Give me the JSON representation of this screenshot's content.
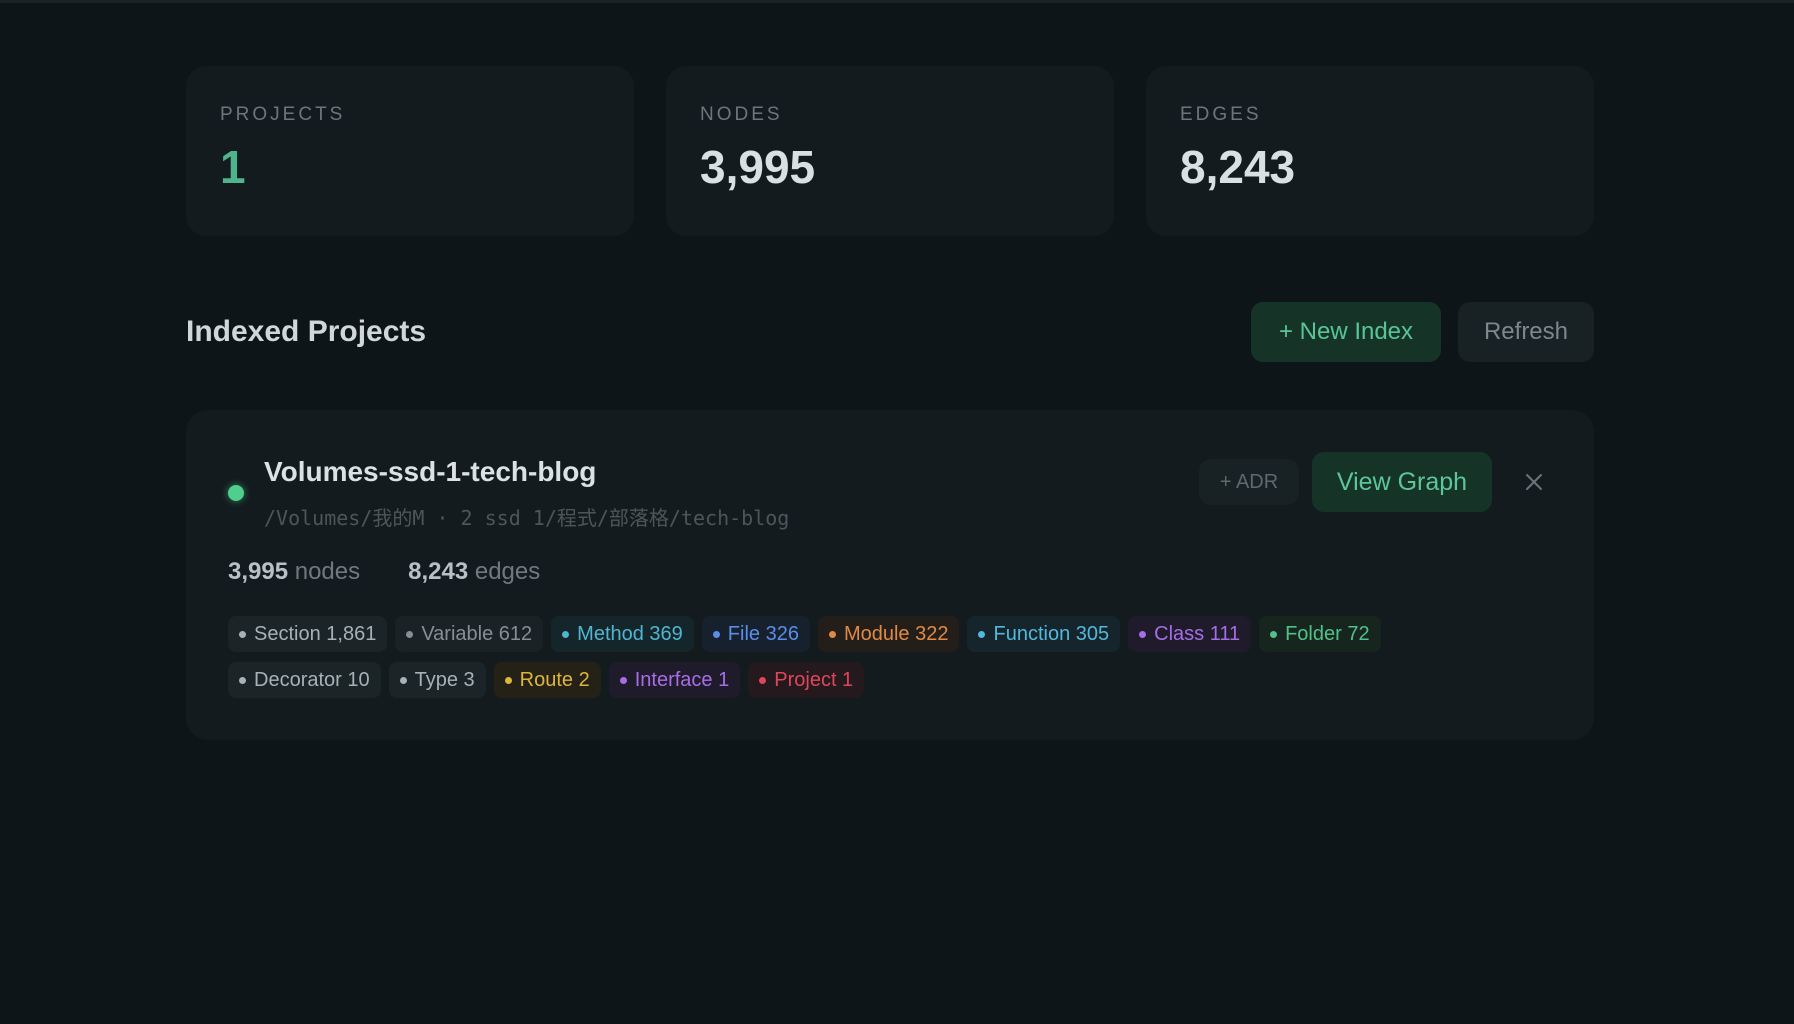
{
  "stats": [
    {
      "label": "PROJECTS",
      "value": "1",
      "accent": true
    },
    {
      "label": "NODES",
      "value": "3,995",
      "accent": false
    },
    {
      "label": "EDGES",
      "value": "8,243",
      "accent": false
    }
  ],
  "section": {
    "title": "Indexed Projects",
    "new_index_label": "+ New Index",
    "refresh_label": "Refresh"
  },
  "project": {
    "name": "Volumes-ssd-1-tech-blog",
    "path": "/Volumes/我的M · 2 ssd 1/程式/部落格/tech-blog",
    "status_color": "#4fcf8c",
    "adr_label": "+ ADR",
    "view_graph_label": "View Graph",
    "close_icon": "close-icon",
    "nodes_count": "3,995",
    "nodes_unit": "nodes",
    "edges_count": "8,243",
    "edges_unit": "edges",
    "tags": [
      {
        "label": "Section 1,861",
        "color": "#a8b1b5",
        "bg": "#1b2427"
      },
      {
        "label": "Variable 612",
        "color": "#858f94",
        "bg": "#1a2225"
      },
      {
        "label": "Method 369",
        "color": "#4fb5d1",
        "bg": "#15262b"
      },
      {
        "label": "File 326",
        "color": "#5b8de8",
        "bg": "#17212e"
      },
      {
        "label": "Module 322",
        "color": "#e08a45",
        "bg": "#231e19"
      },
      {
        "label": "Function 305",
        "color": "#52b8dc",
        "bg": "#15252b"
      },
      {
        "label": "Class 111",
        "color": "#a36ee8",
        "bg": "#1f1b2a"
      },
      {
        "label": "Folder 72",
        "color": "#52c08a",
        "bg": "#16261f"
      },
      {
        "label": "Decorator 10",
        "color": "#a8b1b5",
        "bg": "#1b2427"
      },
      {
        "label": "Type 3",
        "color": "#a8b1b5",
        "bg": "#1b2427"
      },
      {
        "label": "Route 2",
        "color": "#e0b43e",
        "bg": "#242217"
      },
      {
        "label": "Interface 1",
        "color": "#a76ee8",
        "bg": "#1f1b2a"
      },
      {
        "label": "Project 1",
        "color": "#e0455a",
        "bg": "#241a1e"
      }
    ]
  }
}
